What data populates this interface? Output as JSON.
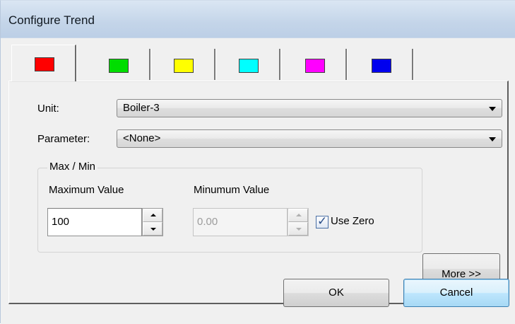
{
  "window": {
    "title": "Configure Trend"
  },
  "tabs": [
    {
      "color": "#ff0000",
      "active": true
    },
    {
      "color": "#00dd00",
      "active": false
    },
    {
      "color": "#ffff00",
      "active": false
    },
    {
      "color": "#00ffff",
      "active": false
    },
    {
      "color": "#ff00ff",
      "active": false
    },
    {
      "color": "#0000ee",
      "active": false
    }
  ],
  "form": {
    "unit_label": "Unit:",
    "unit_value": "Boiler-3",
    "parameter_label": "Parameter:",
    "parameter_value": "<None>",
    "group_title": "Max / Min",
    "max_label": "Maximum Value",
    "max_value": "100",
    "min_label": "Minumum Value",
    "min_value": "0.00",
    "use_zero_label": "Use Zero",
    "use_zero_checked": true,
    "more_label": "More >>"
  },
  "buttons": {
    "ok": "OK",
    "cancel": "Cancel"
  }
}
